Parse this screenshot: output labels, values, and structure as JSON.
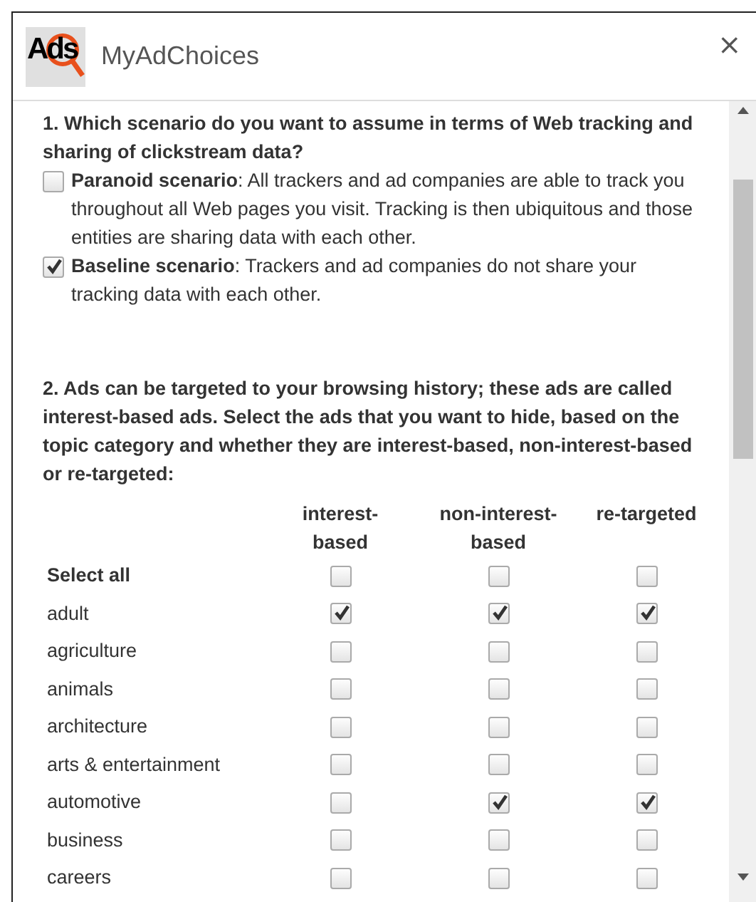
{
  "window": {
    "logo": "Ads",
    "title": "MyAdChoices",
    "close": "×"
  },
  "question_1": {
    "prompt": "1. Which scenario do you want to assume in terms of Web tracking and sharing of clickstream data?",
    "options": [
      {
        "text": "**Paranoid scenario**: All trackers and ad companies are able to track you throughout all Web pages you visit. Tracking is then ubiquitous and those entities are sharing data with each other.",
        "checked": false
      },
      {
        "text": "**Baseline scenario**: Trackers and ad companies do not share your tracking data with each other.",
        "checked": true
      }
    ]
  },
  "question_2": {
    "prompt": "2. Ads can be targeted to your browsing history; these ads are called interest-based ads. Select the ads that you want to hide, based on the topic category and whether they are interest-based, non-interest-based or re-targeted:",
    "columns": [
      "interest-based",
      "non-interest-based",
      "re-targeted"
    ],
    "rows": [
      {
        "kind": "select-all",
        "label": "Select all",
        "checked": [
          false,
          false,
          false
        ]
      },
      {
        "kind": "category",
        "label": "adult",
        "checked": [
          true,
          true,
          true
        ]
      },
      {
        "kind": "category",
        "label": "agriculture",
        "checked": [
          false,
          false,
          false
        ]
      },
      {
        "kind": "category",
        "label": "animals",
        "checked": [
          false,
          false,
          false
        ]
      },
      {
        "kind": "category",
        "label": "architecture",
        "checked": [
          false,
          false,
          false
        ]
      },
      {
        "kind": "category",
        "label": "arts & entertainment",
        "checked": [
          false,
          false,
          false
        ]
      },
      {
        "kind": "category",
        "label": "automotive",
        "checked": [
          false,
          true,
          true
        ]
      },
      {
        "kind": "category",
        "label": "business",
        "checked": [
          false,
          false,
          false
        ]
      },
      {
        "kind": "category",
        "label": "careers",
        "checked": [
          false,
          false,
          false
        ]
      }
    ]
  }
}
